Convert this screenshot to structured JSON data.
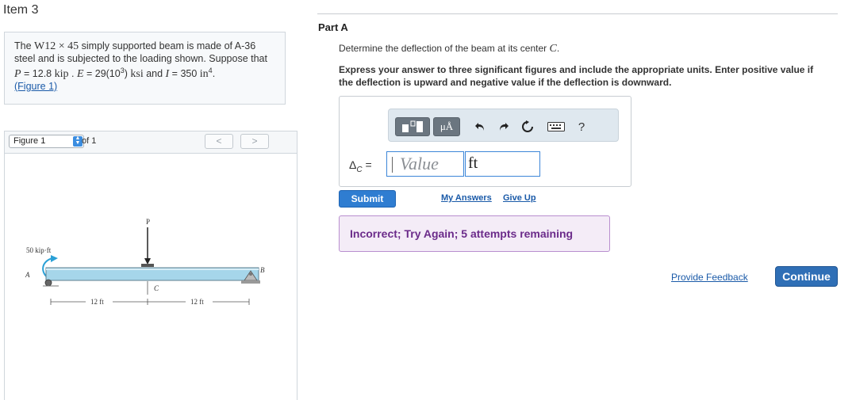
{
  "item": {
    "title": "Item 3"
  },
  "problem": {
    "text1": "The",
    "beam": "W12 × 45",
    "text2": "simply supported beam is made of A-36 steel and is subjected to the loading shown. Suppose that",
    "p_symbol": "P",
    "p_value": " = 12.8 ",
    "p_unit": "kip",
    "sep1": " . ",
    "e_symbol": "E",
    "e_value": " = 29(10",
    "e_exp": "3",
    "e_close": ") ",
    "e_unit": "ksi",
    "and": " and ",
    "i_symbol": "I",
    "i_value": " = 350 ",
    "i_unit": "in",
    "i_exp": "4",
    "end": ".",
    "figure_link": "(Figure 1)"
  },
  "figure": {
    "select_label": "Figure 1",
    "of_label": "of 1",
    "prev_icon": "chevron-left-icon",
    "next_icon": "chevron-right-icon",
    "prev_glyph": "<",
    "next_glyph": ">",
    "diagram": {
      "load_label": "P",
      "moment_label": "50 kip·ft",
      "support_a": "A",
      "support_b": "B",
      "point_c": "C",
      "span_left": "12 ft",
      "span_right": "12 ft"
    },
    "colors": {
      "beam": "#a6d6ea",
      "moment_arrow": "#2aa0d6"
    }
  },
  "part": {
    "title": "Part A",
    "question_prefix": "Determine the deflection of the beam at its center ",
    "question_var": "C",
    "question_suffix": ".",
    "instructions": "Express your answer to three significant figures and include the appropriate units. Enter positive value if the deflection is upward and negative value if the deflection is downward."
  },
  "answer": {
    "toolbar": {
      "templates_icon": "templates-icon",
      "units_label": "μÅ",
      "undo_icon": "undo-icon",
      "redo_icon": "redo-icon",
      "reset_icon": "reset-icon",
      "keyboard_icon": "keyboard-icon",
      "help_label": "?"
    },
    "eq_delta": "Δ",
    "eq_sub": "C",
    "eq_equals": " =",
    "value_placeholder": "Value",
    "units_value": "ft",
    "submit_label": "Submit",
    "my_answers_label": "My Answers",
    "give_up_label": "Give Up",
    "feedback": "Incorrect; Try Again; 5 attempts remaining"
  },
  "footer": {
    "provide_feedback_label": "Provide Feedback",
    "continue_label": "Continue"
  },
  "colors": {
    "accent": "#2f7dd1",
    "link": "#1a5aa8",
    "feedback_bg": "#f4ecf7",
    "feedback_text": "#6b2b8a"
  }
}
